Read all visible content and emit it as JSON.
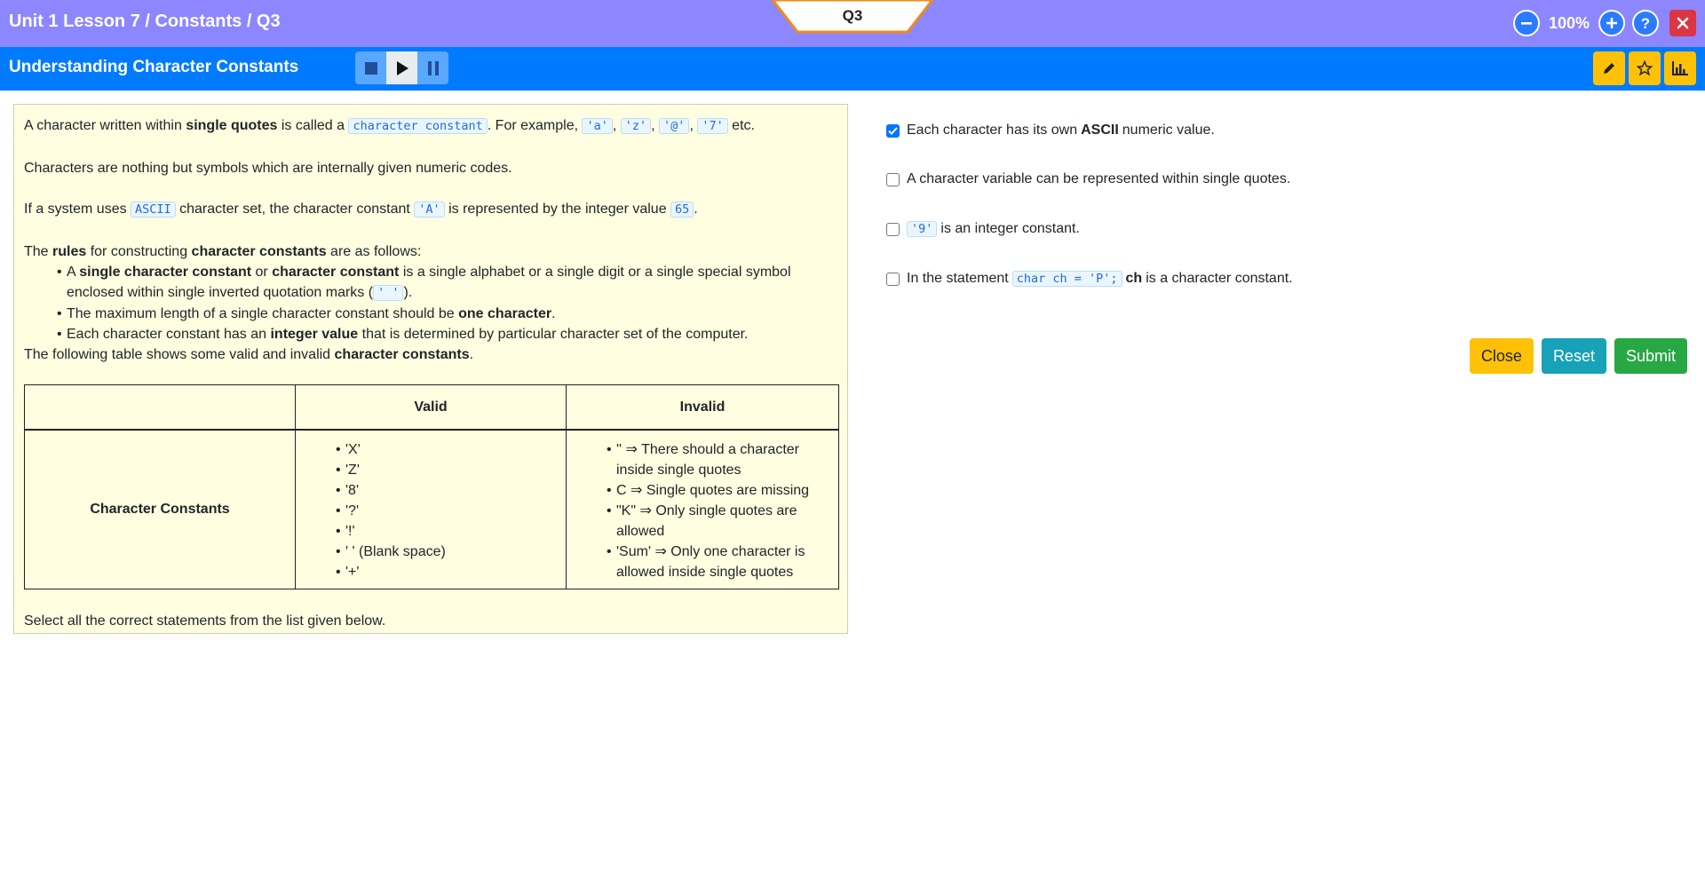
{
  "header": {
    "breadcrumb": "Unit 1 Lesson 7 / Constants / Q3",
    "question_tab": "Q3",
    "zoom": "100%",
    "zoom_out_icon": "minus-circle-icon",
    "zoom_in_icon": "plus-circle-icon",
    "help_icon": "question-icon",
    "close_icon": "close-icon"
  },
  "subheader": {
    "title": "Understanding Character Constants",
    "media_icons": [
      "stop-icon",
      "play-icon",
      "pause-icon"
    ],
    "tool_icons": [
      "pencil-icon",
      "star-icon",
      "bar-chart-icon"
    ]
  },
  "content": {
    "p1": {
      "a": "A character written within ",
      "b": "single quotes",
      "c": " is called a ",
      "code": "character constant",
      "d": ". For example, ",
      "ex": [
        "'a'",
        "'z'",
        "'@'",
        "'7'"
      ],
      "sep": ", ",
      "e": " etc."
    },
    "p2": "Characters are nothing but symbols which are internally given numeric codes.",
    "p3": {
      "a": "If a system uses ",
      "code1": "ASCII",
      "b": " character set, the character constant ",
      "code2": "'A'",
      "c": " is represented by the integer value ",
      "code3": "65",
      "d": "."
    },
    "p4": {
      "a": "The ",
      "b": "rules",
      "c": " for constructing ",
      "d": "character constants",
      "e": " are as follows:"
    },
    "rules": {
      "r1": {
        "a": "A ",
        "b": "single character constant",
        "c": " or ",
        "d": "character constant",
        "e": " is a single alphabet or a single digit or a single special symbol enclosed within single inverted quotation marks (",
        "code": "' '",
        "f": ")."
      },
      "r2": {
        "a": "The maximum length of a single character constant should be ",
        "b": "one character",
        "c": "."
      },
      "r3": {
        "a": "Each character constant has an ",
        "b": "integer value",
        "c": " that is determined by particular character set of the computer."
      }
    },
    "p5": {
      "a": "The following table shows some valid and invalid ",
      "b": "character constants",
      "c": "."
    },
    "table": {
      "headers": [
        "",
        "Valid",
        "Invalid"
      ],
      "row_label": "Character Constants",
      "valid": [
        "'X'",
        "'Z'",
        "'8'",
        "'?'",
        "'!'",
        "' ' (Blank space)",
        "'+'"
      ],
      "invalid": [
        "'' ⇒ There should a character inside single quotes",
        "C ⇒ Single quotes are missing",
        "\"K\" ⇒ Only single quotes are allowed",
        "'Sum' ⇒ Only one character is allowed inside single quotes"
      ]
    },
    "instruction": "Select all the correct statements from the list given below."
  },
  "options": {
    "o1": {
      "a": "Each character has its own ",
      "b": "ASCII",
      "c": " numeric value.",
      "checked": true
    },
    "o2": {
      "a": "A character variable can be represented within single quotes.",
      "checked": false
    },
    "o3": {
      "code": "'9'",
      "a": " is an integer constant.",
      "checked": false
    },
    "o4": {
      "a": "In the statement ",
      "code": "char ch = 'P';",
      "b": " ch",
      "c": " is a character constant.",
      "checked": false
    }
  },
  "buttons": {
    "close": "Close",
    "reset": "Reset",
    "submit": "Submit"
  },
  "colors": {
    "topbar": "#8c87ff",
    "subbar": "#007bff",
    "card": "#fffee0",
    "close": "#ffc107",
    "reset": "#17a2b8",
    "submit": "#28a745",
    "x": "#dc3545"
  }
}
